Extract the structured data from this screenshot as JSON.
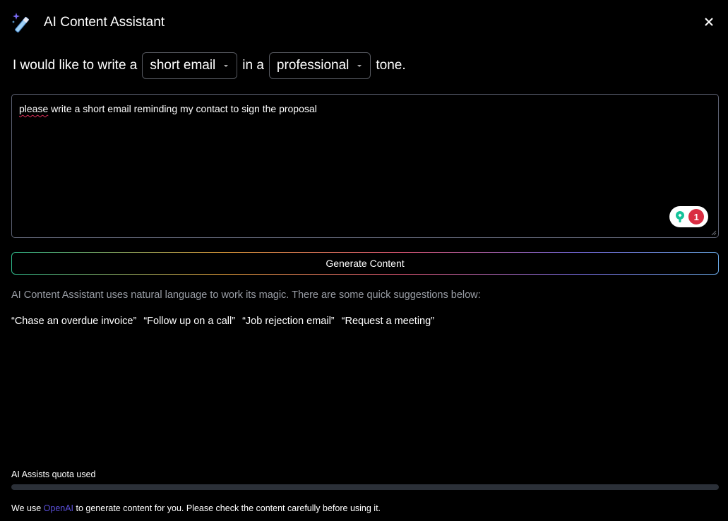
{
  "header": {
    "title": "AI Content Assistant",
    "icon": "magic-wand-icon",
    "close_icon": "close-icon"
  },
  "prompt": {
    "prefix": "I would like to write a",
    "content_type": "short email",
    "middle": "in a",
    "tone": "professional",
    "suffix": "tone."
  },
  "editor": {
    "text_misspelled": "please",
    "text_rest": " write a short email reminding my contact to sign the proposal",
    "grammarly_count": "1"
  },
  "generate_button": {
    "label": "Generate Content"
  },
  "hint": {
    "text": "AI Content Assistant uses natural language to work its magic. There are some quick suggestions below:"
  },
  "suggestions": [
    "“Chase an overdue invoice”",
    "“Follow up on a call”",
    "“Job rejection email”",
    "“Request a meeting”"
  ],
  "quota": {
    "label": "AI Assists quota used",
    "used_fraction": 0
  },
  "footer": {
    "prefix": "We use",
    "link": "OpenAI",
    "suffix": " to generate content for you. Please check the content carefully before using it."
  },
  "colors": {
    "background": "#000000",
    "text": "#ffffff",
    "muted_text": "#9a9ea6",
    "link": "#5a4fd8",
    "spellcheck": "#e0305b",
    "grammarly_badge": "#d92d42",
    "grammarly_logo": "#15c39a"
  }
}
